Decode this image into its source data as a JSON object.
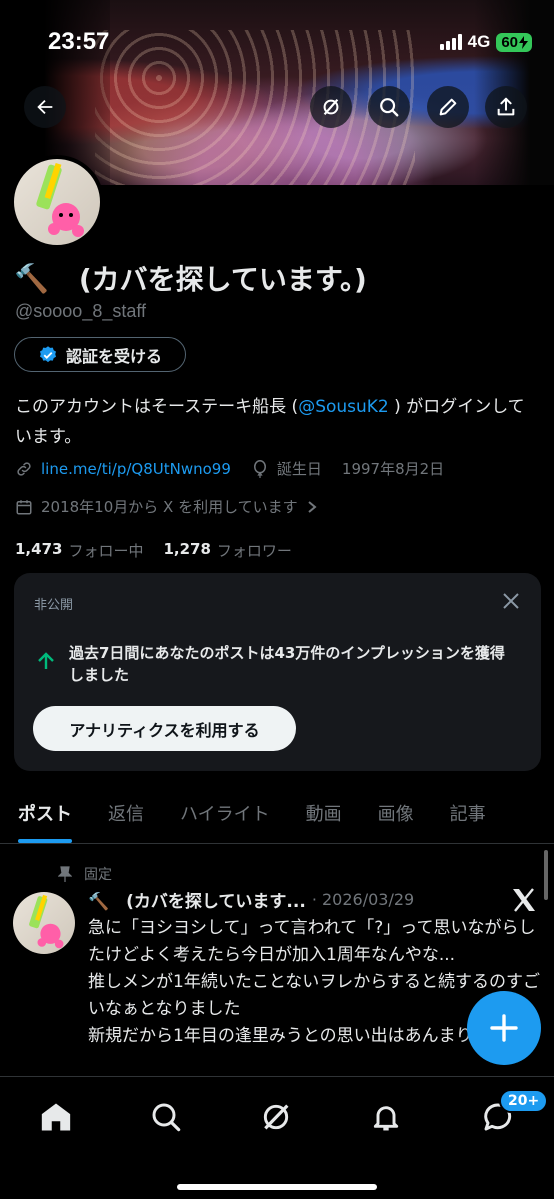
{
  "status_bar": {
    "time": "23:57",
    "network": "4G",
    "battery": "60"
  },
  "profile": {
    "name_emoji": "🔨",
    "name": "(カバを探しています。)",
    "handle": "@soooo_8_staff",
    "verify_label": "認証を受ける",
    "bio_prefix": "このアカウントはそーステーキ船長 (",
    "bio_mention": "@SousuK2",
    "bio_suffix": " ) がログインしています。",
    "link": "line.me/ti/p/Q8UtNwno99",
    "birthday_label": "誕生日",
    "birthday": "1997年8月2日",
    "joined": "2018年10月から X を利用しています",
    "following_count": "1,473",
    "following_label": "フォロー中",
    "followers_count": "1,278",
    "followers_label": "フォロワー"
  },
  "private_card": {
    "label": "非公開",
    "text": "過去7日間にあなたのポストは43万件のインプレッションを獲得しました",
    "button": "アナリティクスを利用する"
  },
  "tabs": [
    "ポスト",
    "返信",
    "ハイライト",
    "動画",
    "画像",
    "記事"
  ],
  "post": {
    "pinned_label": "固定",
    "author": "🔨　(カバを探しています...",
    "date": "· 2026/03/29",
    "body": "急に「ヨシヨシして」って言われて「?」って思いながらしたけどよく考えたら今日が加入1周年なんやな...\n推しメンが1年続いたことないヲレからすると続するのすごいなぁとなりました\n新規だから1年目の逢里みうとの思い出はあんまりな"
  },
  "nav": {
    "notification_badge": "20+"
  },
  "colors": {
    "accent": "#1d9bf0",
    "background": "#000000",
    "muted": "#71767b"
  }
}
